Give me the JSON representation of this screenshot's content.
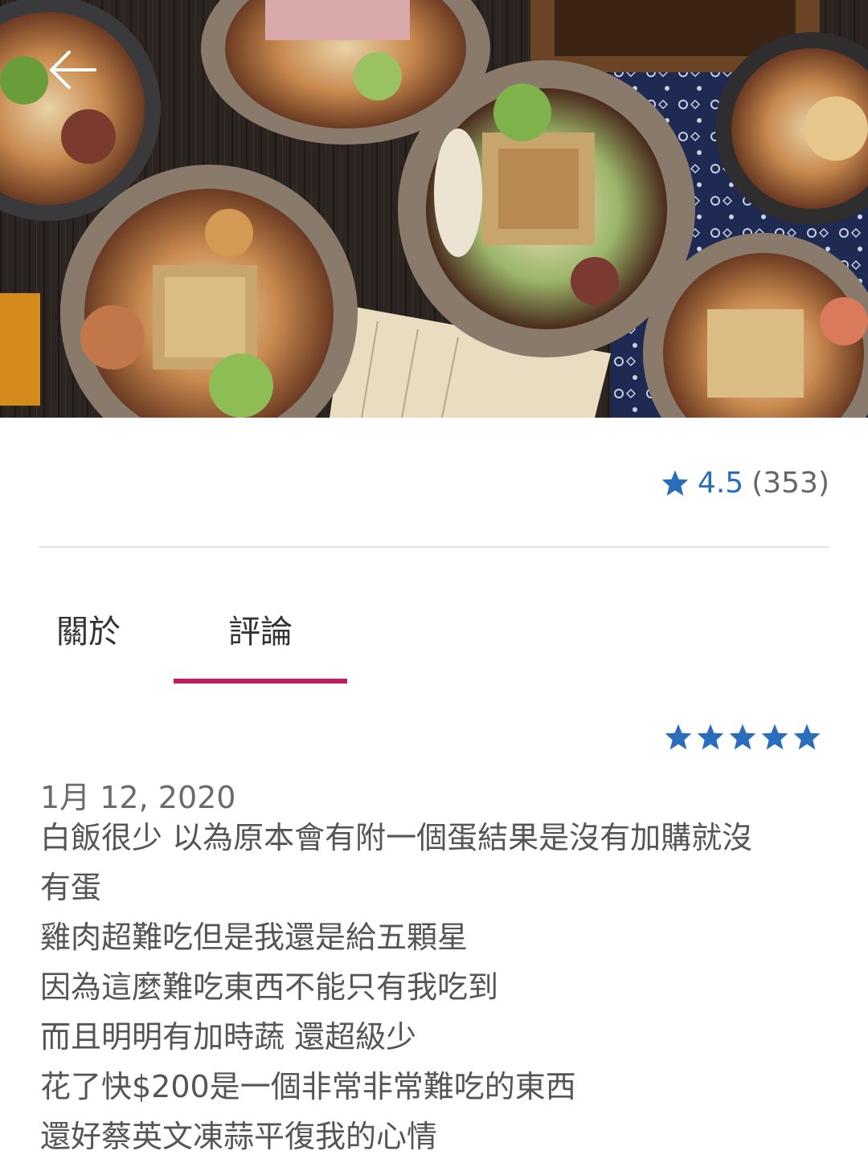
{
  "restaurant": {
    "rating": "4.5",
    "review_count": "(353)"
  },
  "tabs": [
    {
      "label": "關於"
    },
    {
      "label": "評論"
    }
  ],
  "review": {
    "stars": 5,
    "date": "1月 12, 2020",
    "lines": [
      "白飯很少 以為原本會有附一個蛋結果是沒有加購就沒",
      "有蛋",
      "雞肉超難吃但是我還是給五顆星",
      "因為這麼難吃東西不能只有我吃到",
      "而且明明有加時蔬 還超級少",
      "花了快$200是一個非常非常難吃的東西",
      "還好蔡英文凍蒜平復我的心情"
    ]
  },
  "colors": {
    "accent": "#c8195f",
    "star": "#2a6ebb"
  },
  "icons": {
    "back": "arrow-left-icon",
    "rating": "star-icon"
  }
}
